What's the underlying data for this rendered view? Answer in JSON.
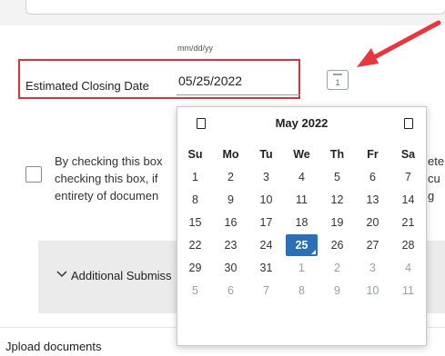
{
  "form": {
    "date_format_hint": "mm/dd/yy",
    "closing_date_label": "Estimated Closing Date",
    "closing_date_value": "05/25/2022",
    "calendar_button_glyph": "1",
    "consent_left": [
      "By checking this box",
      "checking this box, if",
      "entirety of documen"
    ],
    "consent_right": [
      "ete",
      "cu",
      "g"
    ],
    "section_title": "Additional Submiss",
    "upload_label": "Jpload documents"
  },
  "calendar": {
    "month_label": "May 2022",
    "weekdays": [
      "Su",
      "Mo",
      "Tu",
      "We",
      "Th",
      "Fr",
      "Sa"
    ],
    "weeks": [
      [
        {
          "d": "1"
        },
        {
          "d": "2"
        },
        {
          "d": "3"
        },
        {
          "d": "4"
        },
        {
          "d": "5"
        },
        {
          "d": "6"
        },
        {
          "d": "7"
        }
      ],
      [
        {
          "d": "8"
        },
        {
          "d": "9"
        },
        {
          "d": "10"
        },
        {
          "d": "11"
        },
        {
          "d": "12"
        },
        {
          "d": "13"
        },
        {
          "d": "14"
        }
      ],
      [
        {
          "d": "15"
        },
        {
          "d": "16"
        },
        {
          "d": "17"
        },
        {
          "d": "18"
        },
        {
          "d": "19"
        },
        {
          "d": "20"
        },
        {
          "d": "21"
        }
      ],
      [
        {
          "d": "22"
        },
        {
          "d": "23"
        },
        {
          "d": "24"
        },
        {
          "d": "25",
          "selected": true
        },
        {
          "d": "26"
        },
        {
          "d": "27"
        },
        {
          "d": "28"
        }
      ],
      [
        {
          "d": "29"
        },
        {
          "d": "30"
        },
        {
          "d": "31"
        },
        {
          "d": "1",
          "other": true
        },
        {
          "d": "2",
          "other": true
        },
        {
          "d": "3",
          "other": true
        },
        {
          "d": "4",
          "other": true
        }
      ],
      [
        {
          "d": "5",
          "other": true
        },
        {
          "d": "6",
          "other": true
        },
        {
          "d": "7",
          "other": true
        },
        {
          "d": "8",
          "other": true
        },
        {
          "d": "9",
          "other": true
        },
        {
          "d": "10",
          "other": true
        },
        {
          "d": "11",
          "other": true
        }
      ]
    ]
  },
  "colors": {
    "highlight_box": "#e0313b",
    "arrow": "#e8363d",
    "selected_day": "#2c6fb6",
    "section_background": "#ebebeb"
  },
  "icons": {
    "calendar_trigger": "calendar-icon",
    "prev_month": "prev-month-icon",
    "next_month": "next-month-icon",
    "section_toggle": "chevron-down-icon",
    "annotation": "arrow-icon"
  }
}
